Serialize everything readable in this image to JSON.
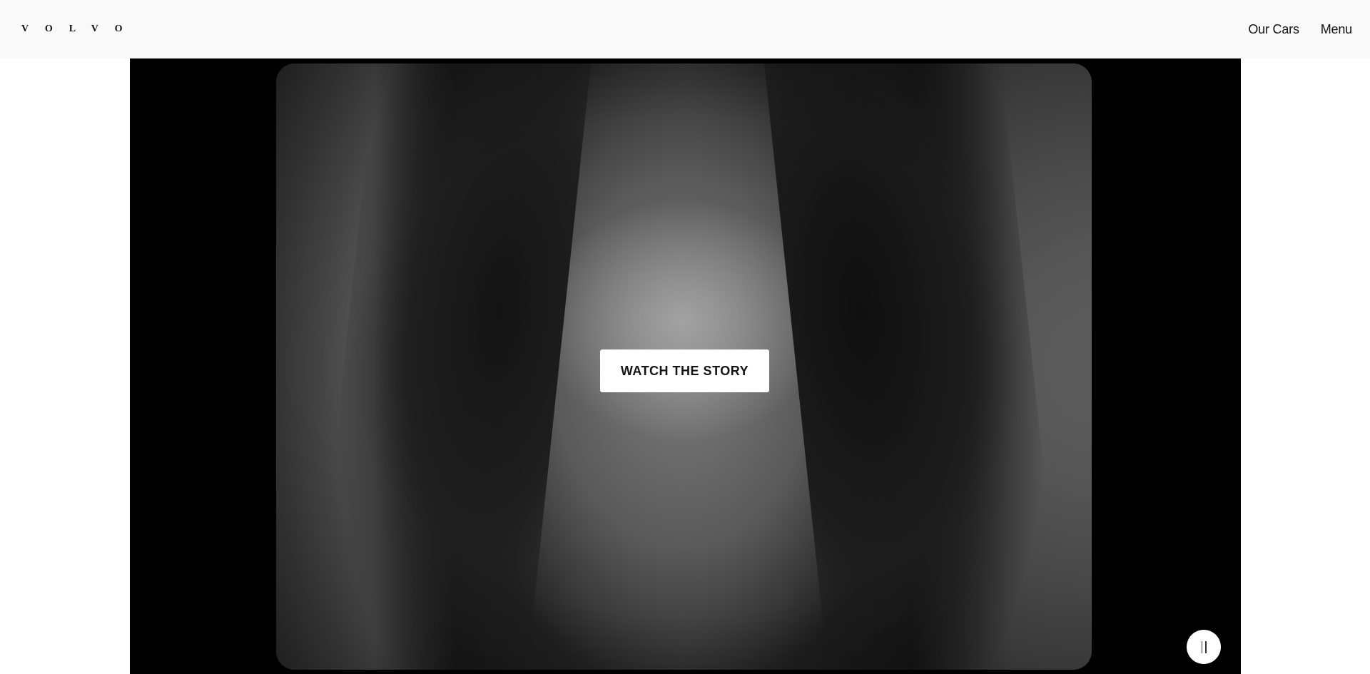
{
  "header": {
    "logo_text": "VOLVO",
    "nav": [
      {
        "label": "Our Cars"
      },
      {
        "label": "Menu"
      }
    ]
  },
  "hero": {
    "cta_label": "WATCH THE STORY",
    "media_state": "playing",
    "pause_icon": "pause-icon"
  },
  "colors": {
    "header_bg": "#f9f9f9",
    "hero_bg": "#000000",
    "button_bg": "#ffffff",
    "text": "#141414"
  }
}
